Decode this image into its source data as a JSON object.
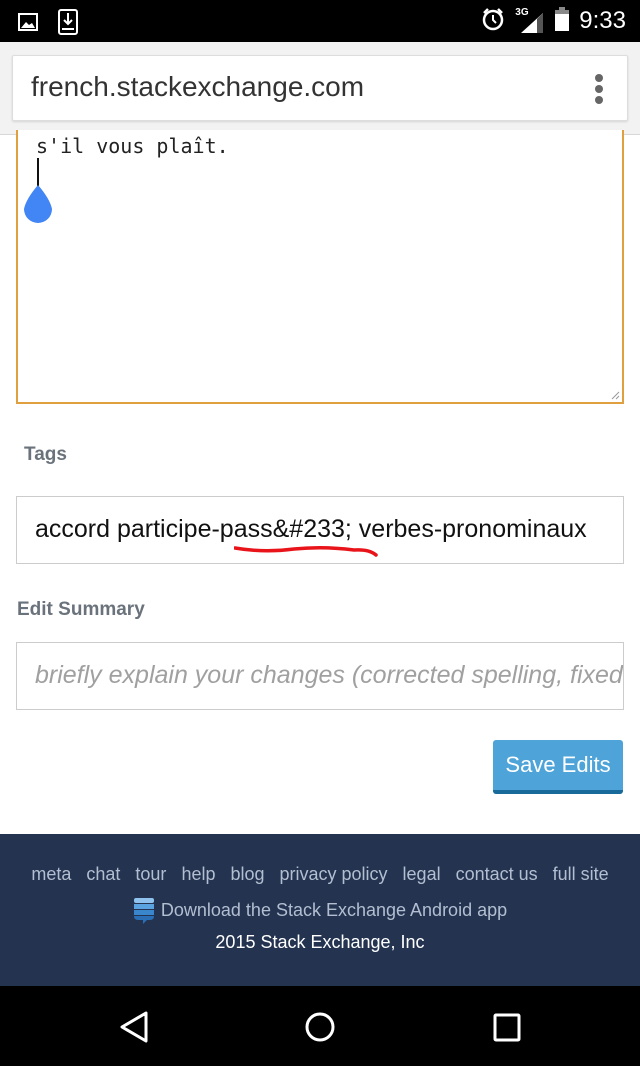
{
  "status_bar": {
    "left_icons": [
      "image-icon",
      "download-icon"
    ],
    "right_icons": [
      "alarm-icon",
      "3g-signal-icon",
      "battery-icon"
    ],
    "network_label": "3G",
    "time": "9:33"
  },
  "browser": {
    "url": "french.stackexchange.com",
    "menu_icon": "overflow-menu-icon"
  },
  "editor": {
    "body_text": "s'il vous plaît.",
    "border_color": "#e0a040"
  },
  "tags": {
    "label": "Tags",
    "value": "accord participe-pass&#233; verbes-pronominaux",
    "annotation": "red underline under \"pass&#233;\""
  },
  "edit_summary": {
    "label": "Edit Summary",
    "placeholder": "briefly explain your changes (corrected spelling, fixed grammar, improved formatting)"
  },
  "save_button": {
    "label": "Save Edits",
    "color": "#4ea3d9"
  },
  "footer": {
    "links": [
      "meta",
      "chat",
      "tour",
      "help",
      "blog",
      "privacy policy",
      "legal",
      "contact us",
      "full site"
    ],
    "app_link": "Download the Stack Exchange Android app",
    "copyright": "2015 Stack Exchange, Inc",
    "background": "#233350"
  },
  "nav_bar": {
    "buttons": [
      "back-icon",
      "home-icon",
      "recents-icon"
    ]
  }
}
